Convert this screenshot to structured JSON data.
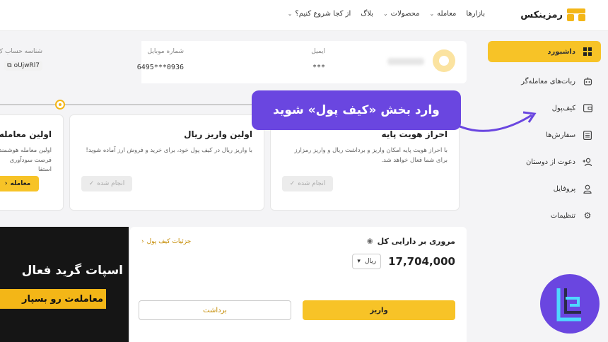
{
  "nav": {
    "logo_text": "رمزینکس",
    "items": [
      {
        "label": "بازارها",
        "has_chevron": false
      },
      {
        "label": "معامله",
        "has_chevron": true
      },
      {
        "label": "محصولات",
        "has_chevron": true
      },
      {
        "label": "بلاگ",
        "has_chevron": false
      },
      {
        "label": "از کجا شروع کنیم؟",
        "has_chevron": true
      }
    ]
  },
  "sidebar": {
    "items": [
      {
        "label": "داشبورد",
        "icon": "grid-icon",
        "active": true
      },
      {
        "label": "ربات‌های معامله‌گر",
        "icon": "robot-icon"
      },
      {
        "label": "کیف‌پول",
        "icon": "wallet-icon",
        "chevron": true
      },
      {
        "label": "سفارش‌ها",
        "icon": "list-icon",
        "chevron": true
      },
      {
        "label": "دعوت از دوستان",
        "icon": "user-plus-icon"
      },
      {
        "label": "پروفایل",
        "icon": "user-icon",
        "chevron": true
      },
      {
        "label": "تنظیمات",
        "icon": "gear-icon"
      }
    ]
  },
  "profile": {
    "email_label": "ایمیل",
    "email_value": "***",
    "mobile_label": "شماره موبایل",
    "mobile_value": "0936***6495",
    "account_id_label": "شناسه حساب ک",
    "account_id_value": "oUjwRl7"
  },
  "steps": [
    {
      "title": "احراز هویت پایه",
      "desc": "با احراز هویت پایه امکان واریز و برداشت ریال و واریز رمزارز برای شما فعال خواهد شد.",
      "button": "انجام شده"
    },
    {
      "title": "اولین واریز ریال",
      "desc": "با واریز ریال در کیف پول خود، برای خرید و فروش ارز آماده شوید!",
      "button": "انجام شده"
    },
    {
      "title": "اولین معامله",
      "desc": "اولین معامله هوشمند فرصت سودآوری استفا",
      "button": "معامله"
    }
  ],
  "callout": {
    "text": "وارد بخش «کیف پول» شوید"
  },
  "assets": {
    "title": "مروری بر دارایی کل",
    "detail_link": "جزئیات کیف پول",
    "balance": "17,704,000",
    "currency": "ریال",
    "deposit_label": "واریز",
    "withdraw_label": "برداشت"
  },
  "promo": {
    "line1": "اسپات گرید فعال",
    "line2": "معامله‌ت رو بسپار"
  },
  "colors": {
    "accent": "#f7c327",
    "callout": "#6a46e0"
  }
}
